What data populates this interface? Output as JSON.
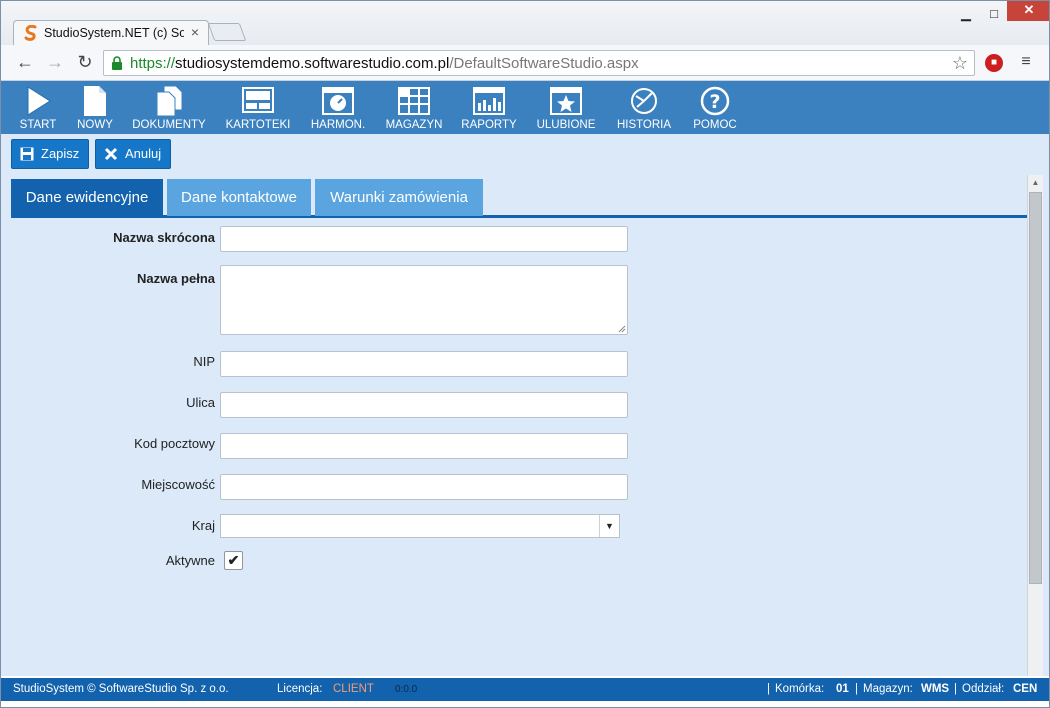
{
  "browser": {
    "tab_title": "StudioSystem.NET (c) Soft",
    "tab_close": "×",
    "window_min": "▁",
    "window_max": "□",
    "window_close": "✕",
    "back": "←",
    "forward": "→",
    "reload": "↻",
    "url_scheme": "https://",
    "url_host": "studiosystemdemo.softwarestudio.com.pl",
    "url_path": "/DefaultSoftwareStudio.aspx",
    "star": "☆",
    "menu": "≡"
  },
  "nav": {
    "items": [
      {
        "label": "START",
        "icon": "play-icon"
      },
      {
        "label": "NOWY",
        "icon": "new-document-icon"
      },
      {
        "label": "DOKUMENTY",
        "icon": "documents-icon"
      },
      {
        "label": "KARTOTEKI",
        "icon": "card-file-icon"
      },
      {
        "label": "HARMON.",
        "icon": "schedule-icon"
      },
      {
        "label": "MAGAZYN",
        "icon": "warehouse-grid-icon"
      },
      {
        "label": "RAPORTY",
        "icon": "report-chart-icon"
      },
      {
        "label": "ULUBIONE",
        "icon": "star-icon"
      },
      {
        "label": "HISTORIA",
        "icon": "history-icon"
      },
      {
        "label": "POMOC",
        "icon": "help-icon"
      }
    ]
  },
  "actions": {
    "save_label": "Zapisz",
    "cancel_label": "Anuluj"
  },
  "tabs": [
    {
      "label": "Dane ewidencyjne",
      "active": true
    },
    {
      "label": "Dane kontaktowe",
      "active": false
    },
    {
      "label": "Warunki zamówienia",
      "active": false
    }
  ],
  "form": {
    "short_name_label": "Nazwa skrócona",
    "short_name_value": "",
    "full_name_label": "Nazwa pełna",
    "full_name_value": "",
    "nip_label": "NIP",
    "nip_value": "",
    "street_label": "Ulica",
    "street_value": "",
    "postal_label": "Kod pocztowy",
    "postal_value": "",
    "city_label": "Miejscowość",
    "city_value": "",
    "country_label": "Kraj",
    "country_value": "",
    "active_label": "Aktywne",
    "active_checked": true,
    "check_mark": "✔",
    "select_arrow": "▼"
  },
  "status": {
    "copyright": "StudioSystem © SoftwareStudio Sp. z o.o.",
    "license_label": "Licencja:",
    "license_value": "CLIENT",
    "timer": "0:0.0",
    "cell_label": "Komórka:",
    "cell_value": "01",
    "warehouse_label": "Magazyn:",
    "warehouse_value": "WMS",
    "branch_label": "Oddział:",
    "branch_value": "CEN"
  },
  "colors": {
    "nav_bg": "#3b81c0",
    "primary": "#1262ad",
    "tab_inactive": "#5aa5df",
    "content_bg": "#dbe9f9",
    "license_accent": "#f39c74"
  }
}
